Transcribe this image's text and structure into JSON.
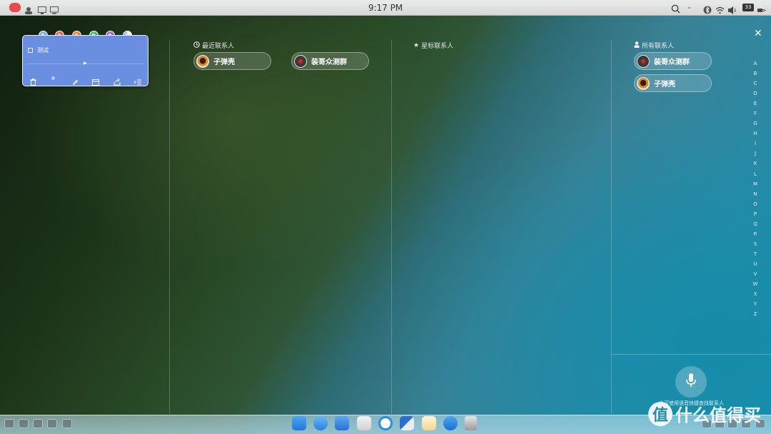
{
  "menubar": {
    "clock": "9:17 PM",
    "battery_level": "33"
  },
  "note": {
    "title": "测试",
    "color_dots": [
      "#8ab0f0",
      "#f06a4a",
      "#f28a3a",
      "#4fc06a",
      "#b06ad8",
      "#a7c4f4"
    ]
  },
  "columns": {
    "recent": {
      "header": "最近联系人",
      "contacts": [
        {
          "name": "子弹壳",
          "avatar": "bullet"
        },
        {
          "name": "装哥众测群",
          "avatar": "group"
        }
      ]
    },
    "starred": {
      "header": "星标联系人"
    },
    "all": {
      "header": "所有联系人",
      "contacts": [
        {
          "name": "装哥众测群",
          "avatar": "group"
        },
        {
          "name": "子弹壳",
          "avatar": "bullet"
        }
      ]
    }
  },
  "alphabet": [
    "A",
    "B",
    "C",
    "D",
    "E",
    "F",
    "G",
    "H",
    "I",
    "J",
    "K",
    "L",
    "M",
    "N",
    "O",
    "P",
    "Q",
    "R",
    "S",
    "T",
    "U",
    "V",
    "W",
    "X",
    "Y",
    "Z"
  ],
  "voice": {
    "hint": "也可使用语音快捷查找联系人"
  },
  "watermark": {
    "logo": "值",
    "text": "什么值得买"
  },
  "colors": {
    "note_bg": "#6b8fe0",
    "menubar_bg": "#e3e4e4"
  }
}
